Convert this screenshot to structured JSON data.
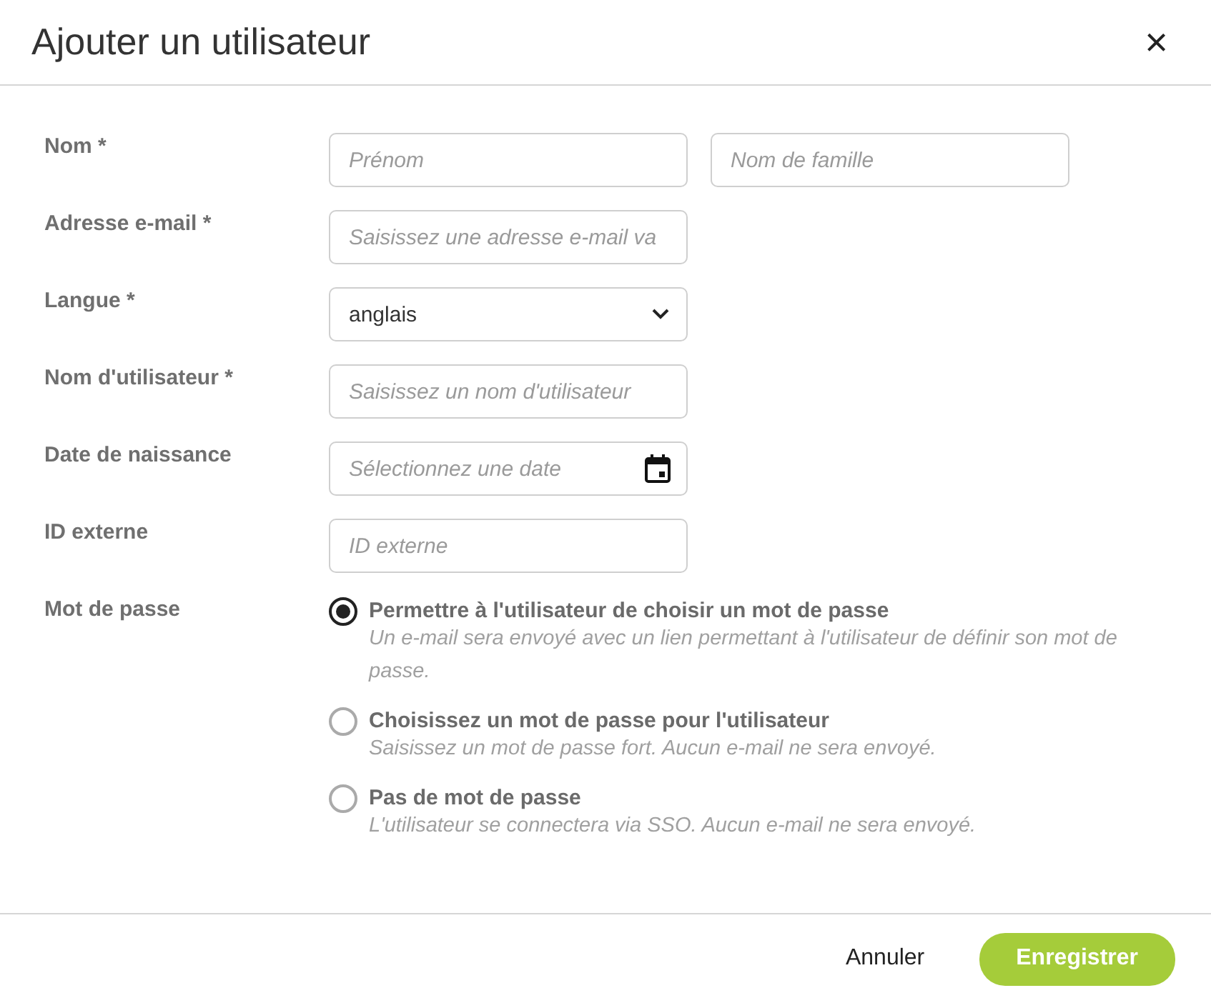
{
  "dialog": {
    "title": "Ajouter un utilisateur",
    "close": "×"
  },
  "fields": [
    {
      "label": "Nom *",
      "kind": "text",
      "inputs": [
        {
          "placeholder": "Prénom"
        },
        {
          "placeholder": "Nom de famille"
        }
      ]
    },
    {
      "label": "Adresse e-mail *",
      "kind": "text",
      "inputs": [
        {
          "placeholder": "Saisissez une adresse e-mail va"
        }
      ]
    },
    {
      "label": "Langue *",
      "kind": "select",
      "inputs": [
        {
          "value": "anglais"
        }
      ]
    },
    {
      "label": "Nom d'utilisateur *",
      "kind": "text",
      "inputs": [
        {
          "placeholder": "Saisissez un nom d'utilisateur"
        }
      ]
    },
    {
      "label": "Date de naissance",
      "kind": "date",
      "inputs": [
        {
          "placeholder": "Sélectionnez une date"
        }
      ]
    },
    {
      "label": "ID externe",
      "kind": "text",
      "inputs": [
        {
          "placeholder": "ID externe"
        }
      ]
    }
  ],
  "password": {
    "label": "Mot de passe",
    "options": [
      {
        "title": "Permettre à l'utilisateur de choisir un mot de passe",
        "description": "Un e-mail sera envoyé avec un lien permettant à l'utilisateur de définir son mot de passe.",
        "selected": true
      },
      {
        "title": "Choisissez un mot de passe pour l'utilisateur",
        "description": "Saisissez un mot de passe fort. Aucun e-mail ne sera envoyé.",
        "selected": false
      },
      {
        "title": "Pas de mot de passe",
        "description": "L'utilisateur se connectera via SSO. Aucun e-mail ne sera envoyé.",
        "selected": false
      }
    ]
  },
  "buttons": [
    {
      "label": "Annuler",
      "kind": "secondary"
    },
    {
      "label": "Enregistrer",
      "kind": "primary"
    }
  ]
}
